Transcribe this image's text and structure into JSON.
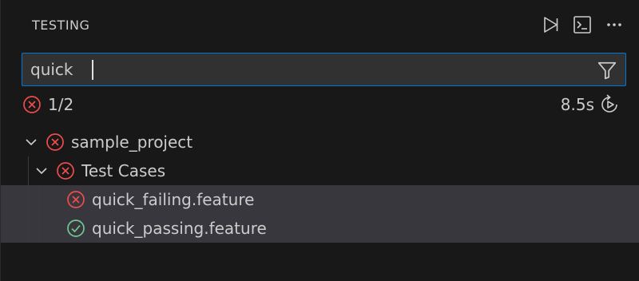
{
  "panel": {
    "title": "TESTING",
    "actions": [
      {
        "icon": "run-tests-icon",
        "label": "Run Tests"
      },
      {
        "icon": "terminal-icon",
        "label": "Show Output"
      },
      {
        "icon": "more-icon",
        "label": "More Actions"
      }
    ]
  },
  "filter": {
    "value": "quick",
    "icon": "filter-icon"
  },
  "summary": {
    "status_icon": "error-circle-icon",
    "count": "1/2",
    "duration": "8.5s",
    "rerun_icon": "rerun-icon"
  },
  "tree": [
    {
      "label": "sample_project",
      "status": "failed",
      "expanded": true,
      "depth": 0
    },
    {
      "label": "Test Cases",
      "status": "failed",
      "expanded": true,
      "depth": 1
    },
    {
      "label": "quick_failing.feature",
      "status": "failed",
      "depth": 2,
      "selected": true
    },
    {
      "label": "quick_passing.feature",
      "status": "passed",
      "depth": 2,
      "selected": true
    }
  ],
  "colors": {
    "failed": "#f14c4c",
    "passed": "#73c991",
    "accent": "#0078d4"
  }
}
